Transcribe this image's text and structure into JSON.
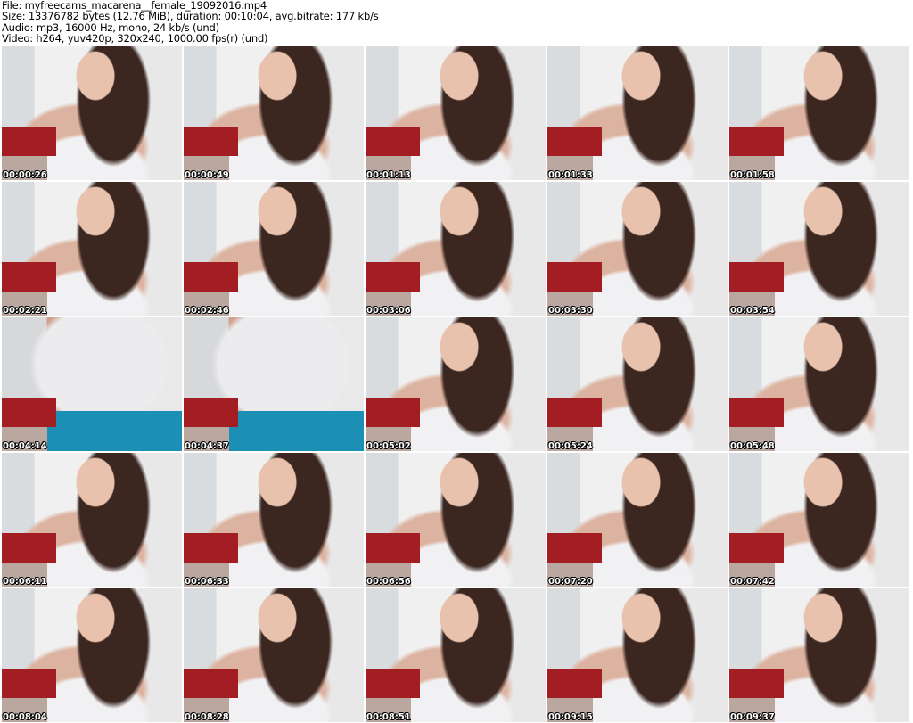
{
  "header": {
    "file": "File: myfreecams_macarena__female_19092016.mp4",
    "size": "Size: 13376782 bytes (12.76 MiB), duration: 00:10:04, avg.bitrate: 177 kb/s",
    "audio": "Audio: mp3, 16000 Hz, mono, 24 kb/s (und)",
    "video": "Video: h264, yuv420p, 320x240, 1000.00 fps(r) (und)"
  },
  "thumbnails": [
    {
      "time": "00:00:26"
    },
    {
      "time": "00:00:49"
    },
    {
      "time": "00:01:13"
    },
    {
      "time": "00:01:33"
    },
    {
      "time": "00:01:58"
    },
    {
      "time": "00:02:21"
    },
    {
      "time": "00:02:46"
    },
    {
      "time": "00:03:06"
    },
    {
      "time": "00:03:30"
    },
    {
      "time": "00:03:54"
    },
    {
      "time": "00:04:14"
    },
    {
      "time": "00:04:37"
    },
    {
      "time": "00:05:02"
    },
    {
      "time": "00:05:24"
    },
    {
      "time": "00:05:48"
    },
    {
      "time": "00:06:11"
    },
    {
      "time": "00:06:33"
    },
    {
      "time": "00:06:56"
    },
    {
      "time": "00:07:20"
    },
    {
      "time": "00:07:42"
    },
    {
      "time": "00:08:04"
    },
    {
      "time": "00:08:28"
    },
    {
      "time": "00:08:51"
    },
    {
      "time": "00:09:15"
    },
    {
      "time": "00:09:37"
    }
  ]
}
